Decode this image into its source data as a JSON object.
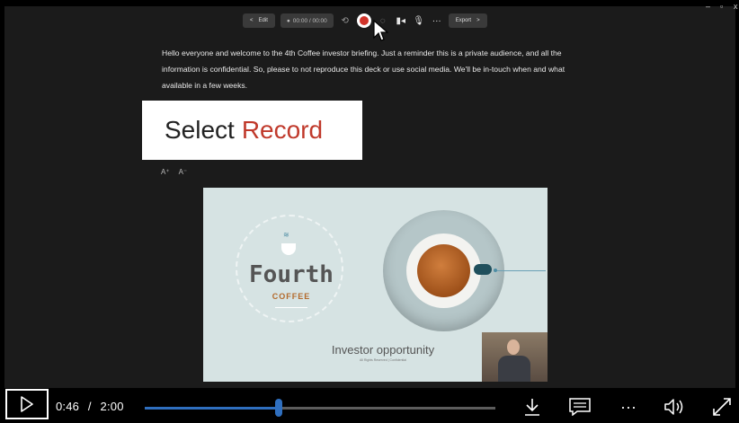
{
  "window": {
    "minimize_label": "–",
    "maximize_label": "▫",
    "close_label": "x"
  },
  "toolbar": {
    "edit_label": "Edit",
    "timer_text": "00:00 / 00:00",
    "export_label": "Export"
  },
  "prompt_text": "Hello everyone and welcome to the 4th Coffee investor briefing. Just a reminder this is a private audience, and all the information is confidential. So, please to not reproduce this deck or use social media. We'll be in-touch when and what available in a few weeks.",
  "callout": {
    "prefix": "Select",
    "highlight": "Record"
  },
  "font_size_controls": {
    "increase": "A⁺",
    "decrease": "A⁻"
  },
  "slide": {
    "brand_top": "Fourth",
    "brand_bottom": "COFFEE",
    "title": "Investor opportunity",
    "subtitle": "All Rights Reserved | Confidential"
  },
  "player": {
    "current_time": "0:46",
    "separator": "/",
    "duration": "2:00",
    "progress_fraction": 0.383,
    "icons": [
      "play-icon",
      "download-icon",
      "captions-icon",
      "more-icon",
      "volume-icon",
      "fullscreen-icon"
    ]
  },
  "colors": {
    "accent": "#2f6fbf",
    "record": "#d1342b",
    "highlight_text": "#c0392b"
  }
}
